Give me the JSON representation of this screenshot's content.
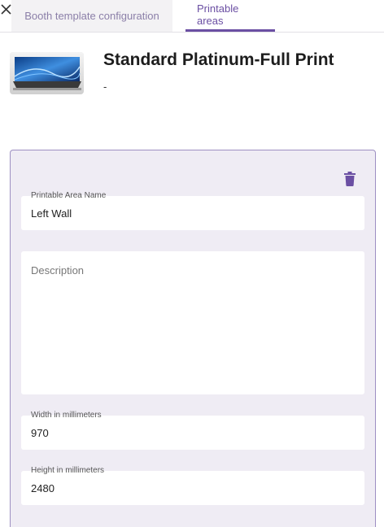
{
  "tabs": [
    {
      "label": "Booth template configuration"
    },
    {
      "label": "Printable areas"
    }
  ],
  "product": {
    "title": "Standard Platinum-Full Print",
    "subtitle": "-"
  },
  "fields": {
    "name": {
      "label": "Printable Area Name",
      "value": "Left Wall"
    },
    "description": {
      "placeholder": "Description"
    },
    "width": {
      "label": "Width in millimeters",
      "value": "970"
    },
    "height": {
      "label": "Height in millimeters",
      "value": "2480"
    }
  },
  "colors": {
    "accent": "#6b4fa3",
    "card_bg": "#efecf4",
    "card_border": "#9d8fc2"
  }
}
